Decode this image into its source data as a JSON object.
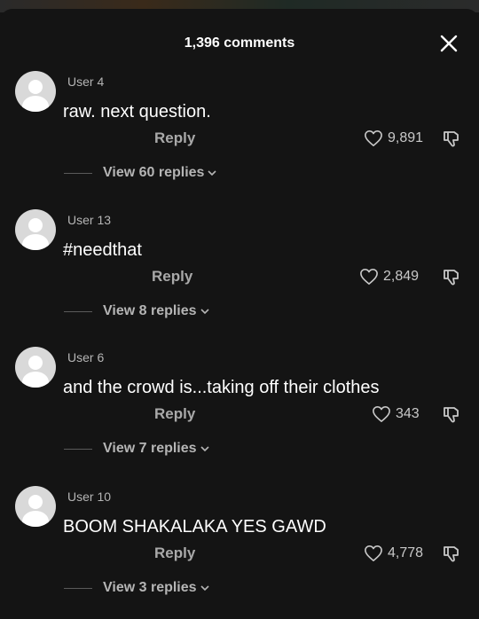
{
  "header": {
    "title": "1,396 comments"
  },
  "comments": [
    {
      "user": "User 4",
      "text": "raw. next question.",
      "reply_label": "Reply",
      "likes": "9,891",
      "view_replies": "View 60 replies"
    },
    {
      "user": "User 13",
      "text": "#needthat",
      "reply_label": "Reply",
      "likes": "2,849",
      "view_replies": "View 8 replies"
    },
    {
      "user": "User 6",
      "text": "and the crowd is...taking off their clothes",
      "reply_label": "Reply",
      "likes": "343",
      "view_replies": "View 7 replies"
    },
    {
      "user": "User 10",
      "text": "BOOM SHAKALAKA YES GAWD",
      "reply_label": "Reply",
      "likes": "4,778",
      "view_replies": "View 3 replies"
    }
  ],
  "icons": {
    "close": "close-icon",
    "like": "heart-icon",
    "dislike": "thumbs-down-icon",
    "expand": "chevron-down-icon",
    "avatar": "default-avatar-icon"
  },
  "colors": {
    "background": "#141414",
    "primary_text": "#ffffff",
    "secondary_text": "#b5b5b5"
  }
}
